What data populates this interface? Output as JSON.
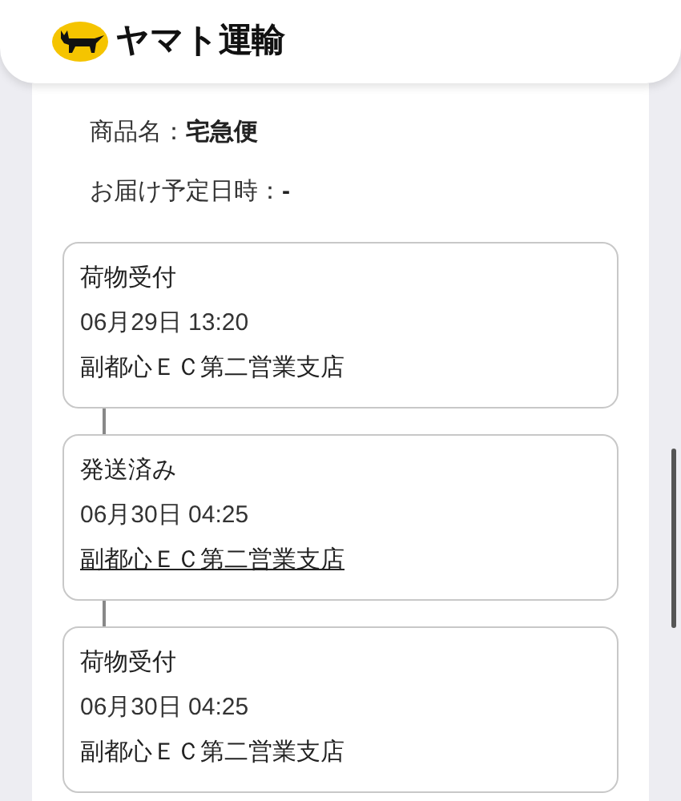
{
  "header": {
    "logo_text": "ヤマト運輸"
  },
  "product": {
    "label": "商品名：",
    "value": "宅急便"
  },
  "delivery": {
    "label": "お届け予定日時：",
    "value": "-"
  },
  "events": [
    {
      "status": "荷物受付",
      "datetime": "06月29日 13:20",
      "branch": "副都心ＥＣ第二営業支店",
      "linked": false
    },
    {
      "status": "発送済み",
      "datetime": "06月30日 04:25",
      "branch": "副都心ＥＣ第二営業支店",
      "linked": true
    },
    {
      "status": "荷物受付",
      "datetime": "06月30日 04:25",
      "branch": "副都心ＥＣ第二営業支店",
      "linked": false
    }
  ]
}
